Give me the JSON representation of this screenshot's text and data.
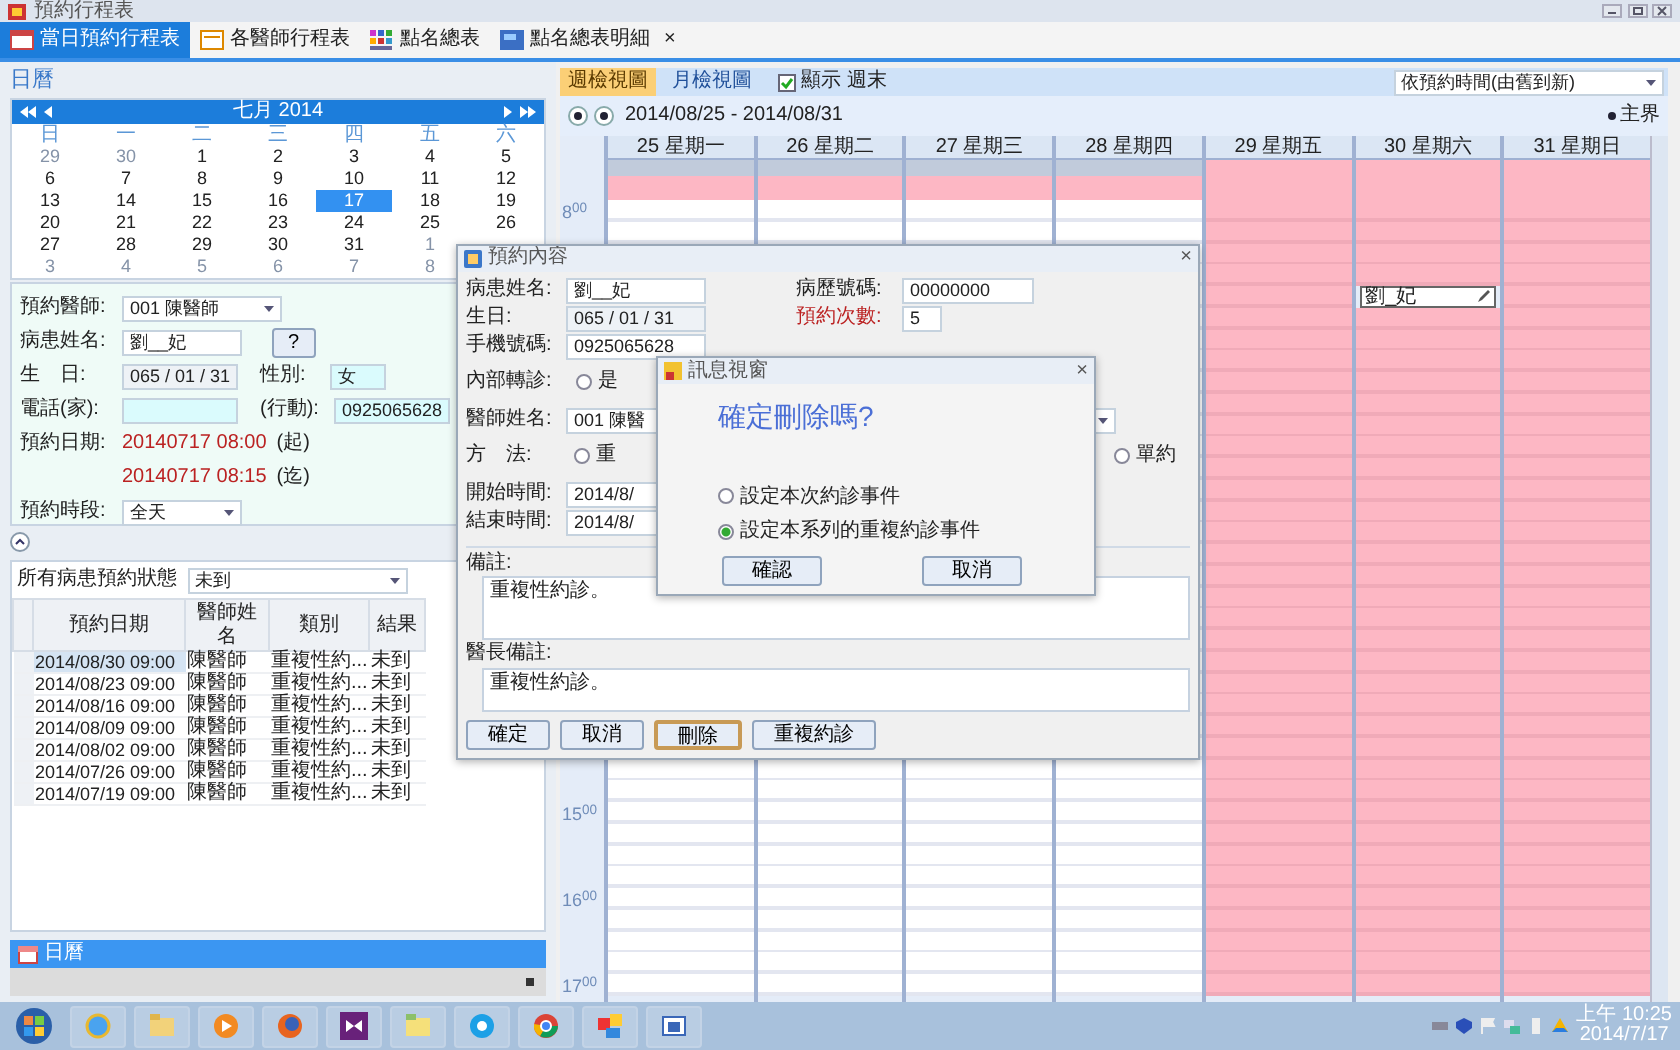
{
  "window": {
    "title": "預約行程表"
  },
  "tabs": [
    {
      "label": "當日預約行程表",
      "selected": true
    },
    {
      "label": "各醫師行程表",
      "selected": false
    },
    {
      "label": "點名總表",
      "selected": false
    },
    {
      "label": "點名總表明細",
      "selected": false,
      "close": "×"
    }
  ],
  "calendar": {
    "heading": "日曆",
    "month": "七月 2014",
    "weekdays": [
      "日",
      "一",
      "二",
      "三",
      "四",
      "五",
      "六"
    ],
    "weeks": [
      [
        {
          "day": "29",
          "muted": true,
          "selected": false
        },
        {
          "day": "30",
          "muted": true,
          "selected": false
        },
        {
          "day": "1",
          "muted": false,
          "selected": false
        },
        {
          "day": "2",
          "muted": false,
          "selected": false
        },
        {
          "day": "3",
          "muted": false,
          "selected": false
        },
        {
          "day": "4",
          "muted": false,
          "selected": false
        },
        {
          "day": "5",
          "muted": false,
          "selected": false
        }
      ],
      [
        {
          "day": "6",
          "muted": false,
          "selected": false
        },
        {
          "day": "7",
          "muted": false,
          "selected": false
        },
        {
          "day": "8",
          "muted": false,
          "selected": false
        },
        {
          "day": "9",
          "muted": false,
          "selected": false
        },
        {
          "day": "10",
          "muted": false,
          "selected": false
        },
        {
          "day": "11",
          "muted": false,
          "selected": false
        },
        {
          "day": "12",
          "muted": false,
          "selected": false
        }
      ],
      [
        {
          "day": "13",
          "muted": false,
          "selected": false
        },
        {
          "day": "14",
          "muted": false,
          "selected": false
        },
        {
          "day": "15",
          "muted": false,
          "selected": false
        },
        {
          "day": "16",
          "muted": false,
          "selected": false
        },
        {
          "day": "17",
          "muted": false,
          "selected": true
        },
        {
          "day": "18",
          "muted": false,
          "selected": false
        },
        {
          "day": "19",
          "muted": false,
          "selected": false
        }
      ],
      [
        {
          "day": "20",
          "muted": false,
          "selected": false
        },
        {
          "day": "21",
          "muted": false,
          "selected": false
        },
        {
          "day": "22",
          "muted": false,
          "selected": false
        },
        {
          "day": "23",
          "muted": false,
          "selected": false
        },
        {
          "day": "24",
          "muted": false,
          "selected": false
        },
        {
          "day": "25",
          "muted": false,
          "selected": false
        },
        {
          "day": "26",
          "muted": false,
          "selected": false
        }
      ],
      [
        {
          "day": "27",
          "muted": false,
          "selected": false
        },
        {
          "day": "28",
          "muted": false,
          "selected": false
        },
        {
          "day": "29",
          "muted": false,
          "selected": false
        },
        {
          "day": "30",
          "muted": false,
          "selected": false
        },
        {
          "day": "31",
          "muted": false,
          "selected": false
        },
        {
          "day": "1",
          "muted": true,
          "selected": false
        }
      ],
      [
        {
          "day": "3",
          "muted": true,
          "selected": false
        },
        {
          "day": "4",
          "muted": true,
          "selected": false
        },
        {
          "day": "5",
          "muted": true,
          "selected": false
        },
        {
          "day": "6",
          "muted": true,
          "selected": false
        },
        {
          "day": "7",
          "muted": true,
          "selected": false
        },
        {
          "day": "8",
          "muted": true,
          "selected": false
        }
      ]
    ]
  },
  "booking": {
    "doctor_label": "預約醫師:",
    "doctor": "001 陳醫師",
    "patient_label": "病患姓名:",
    "patient": "劉__妃",
    "lookup_button": "?",
    "birthday_label": "生　日:",
    "birthday": "065 / 01 / 31",
    "sex_label": "性別:",
    "sex": "女",
    "home_phone_label": "電話(家):",
    "mobile_label": "(行動):",
    "mobile": "0925065628",
    "date_label": "預約日期:",
    "start": "20140717 08:00",
    "start_tag": "(起)",
    "end": "20140717 08:15",
    "end_tag": "(迄)",
    "period_label": "預約時段:",
    "period": "全天"
  },
  "appointments": {
    "filter_label": "所有病患預約狀態",
    "filter": "未到",
    "columns": [
      "預約日期",
      "醫師姓名",
      "類別",
      "結果"
    ],
    "rows": [
      {
        "cells": [
          "2014/08/30 09:00",
          "陳醫師",
          "重複性約...",
          "未到"
        ],
        "selected": true
      },
      {
        "cells": [
          "2014/08/23 09:00",
          "陳醫師",
          "重複性約...",
          "未到"
        ],
        "selected": false
      },
      {
        "cells": [
          "2014/08/16 09:00",
          "陳醫師",
          "重複性約...",
          "未到"
        ],
        "selected": false
      },
      {
        "cells": [
          "2014/08/09 09:00",
          "陳醫師",
          "重複性約...",
          "未到"
        ],
        "selected": false
      },
      {
        "cells": [
          "2014/08/02 09:00",
          "陳醫師",
          "重複性約...",
          "未到"
        ],
        "selected": false
      },
      {
        "cells": [
          "2014/07/26 09:00",
          "陳醫師",
          "重複性約...",
          "未到"
        ],
        "selected": false
      },
      {
        "cells": [
          "2014/07/19 09:00",
          "陳醫師",
          "重複性約...",
          "未到"
        ],
        "selected": false
      }
    ]
  },
  "bottom_tab": {
    "label": "日曆"
  },
  "scheduler": {
    "views": [
      {
        "label": "週檢視圖",
        "selected": true
      },
      {
        "label": "月檢視圖",
        "selected": false
      }
    ],
    "weekend": {
      "label": "顯示 週末",
      "checked": true
    },
    "sort": "依預約時間(由舊到新)",
    "range": "2014/08/25 - 2014/08/31",
    "legend": "主界",
    "days": [
      {
        "label": "25 星期一",
        "blocked": false
      },
      {
        "label": "26 星期二",
        "blocked": false
      },
      {
        "label": "27 星期三",
        "blocked": false
      },
      {
        "label": "28 星期四",
        "blocked": false
      },
      {
        "label": "29 星期五",
        "blocked": true
      },
      {
        "label": "30 星期六",
        "blocked": true,
        "event": "劉_妃"
      },
      {
        "label": "31 星期日",
        "blocked": true
      }
    ],
    "hour_labels": [
      "8$^{00}$",
      "15$^{00}$",
      "16$^{00}$",
      "17$^{00}$"
    ]
  },
  "appointment_dialog": {
    "title": "預約內容",
    "close": "×",
    "patient_label": "病患姓名:",
    "patient": "劉__妃",
    "chart_label": "病歷號碼:",
    "chart": "00000000",
    "birthday_label": "生日:",
    "birthday": "065 / 01 / 31",
    "visits_label": "預約次數:",
    "visits": "5",
    "mobile_label": "手機號碼:",
    "mobile": "0925065628",
    "referral_label": "內部轉診:",
    "referral_option": "是",
    "referral_checked": false,
    "doctor_label": "醫師姓名:",
    "doctor": "001 陳醫",
    "method_label": "方　法:",
    "method_options": [
      {
        "label": "重",
        "selected": false
      },
      {
        "label": "單約",
        "selected": false
      }
    ],
    "start_label": "開始時間:",
    "start": "2014/8/",
    "end_label": "結束時間:",
    "end": "2014/8/",
    "note_label": "備註:",
    "note": "重複性約診。",
    "doctor_note_label": "醫長備註:",
    "doctor_note": "重複性約診。",
    "buttons": [
      {
        "label": "確定",
        "focused": false
      },
      {
        "label": "取消",
        "focused": false
      },
      {
        "label": "刪除",
        "focused": true
      },
      {
        "label": "重複約診",
        "focused": false
      }
    ]
  },
  "message_box": {
    "title": "訊息視窗",
    "close": "×",
    "question": "確定刪除嗎?",
    "options": [
      {
        "label": "設定本次約診事件",
        "selected": false
      },
      {
        "label": "設定本系列的重複約診事件",
        "selected": true
      }
    ],
    "buttons": [
      "確認",
      "取消"
    ]
  },
  "taskbar": {
    "time": "上午 10:25",
    "date": "2014/7/17"
  }
}
